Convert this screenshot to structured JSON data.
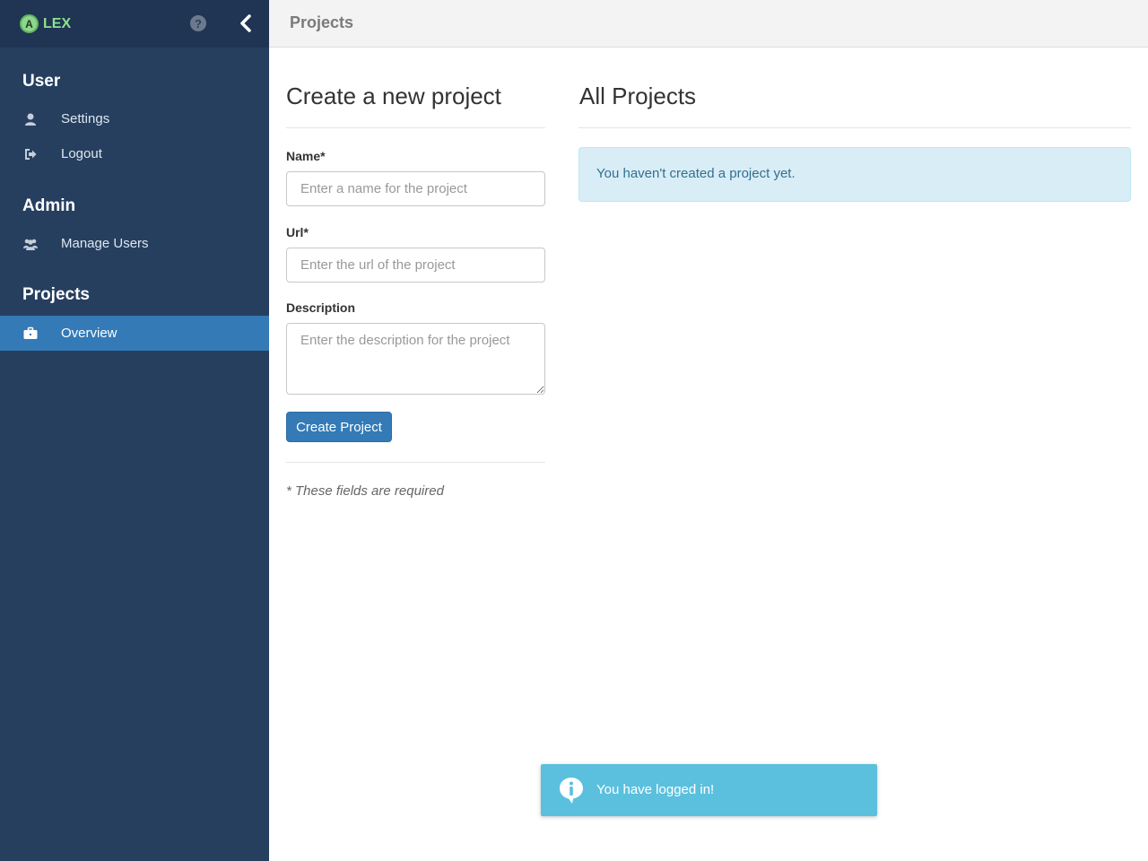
{
  "app": {
    "logo_letter": "A",
    "logo_text": "LEX",
    "help_glyph": "?"
  },
  "icons": {
    "help": "question-circle-icon",
    "collapse": "chevron-left-icon",
    "settings": "user-icon",
    "logout": "sign-out-icon",
    "manage_users": "users-icon",
    "overview": "briefcase-icon",
    "toast": "info-speech-icon"
  },
  "sidebar": {
    "sections": [
      {
        "title": "User",
        "items": [
          {
            "label": "Settings"
          },
          {
            "label": "Logout"
          }
        ]
      },
      {
        "title": "Admin",
        "items": [
          {
            "label": "Manage Users"
          }
        ]
      },
      {
        "title": "Projects",
        "items": [
          {
            "label": "Overview",
            "active": true
          }
        ]
      }
    ]
  },
  "header": {
    "title": "Projects"
  },
  "create_form": {
    "heading": "Create a new project",
    "name_label": "Name*",
    "name_value": "",
    "name_placeholder": "Enter a name for the project",
    "url_label": "Url*",
    "url_value": "",
    "url_placeholder": "Enter the url of the project",
    "description_label": "Description",
    "description_value": "",
    "description_placeholder": "Enter the description for the project",
    "submit_label": "Create Project",
    "required_note": "* These fields are required"
  },
  "projects": {
    "heading": "All Projects",
    "empty_message": "You haven't created a project yet."
  },
  "toast": {
    "message": "You have logged in!"
  },
  "colors": {
    "sidebar_bg": "#263f5f",
    "sidebar_top_bg": "#1f3553",
    "active_item": "#337ab7",
    "primary_button": "#337ab7",
    "info_box_bg": "#d9edf7",
    "info_box_text": "#31708f",
    "toast_bg": "#5bc0de",
    "logo_green": "#8fe08f"
  }
}
